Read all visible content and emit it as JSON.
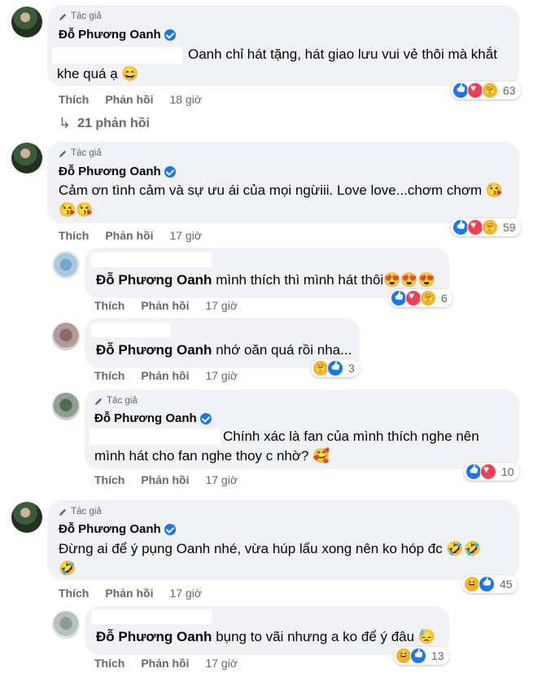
{
  "labels": {
    "author_tag": "Tác giả",
    "like": "Thích",
    "reply": "Phản hồi"
  },
  "comments": [
    {
      "author": "Đỗ Phương Oanh",
      "line1": "Oanh chỉ hát tặng, hát giao lưu vui vẻ thôi mà khắt",
      "line2": "khe quá ạ 😄",
      "time": "18 giờ",
      "reactions": [
        "like",
        "love",
        "care"
      ],
      "count": "63"
    },
    {
      "replies_label": "21 phản hồi"
    },
    {
      "author": "Đỗ Phương Oanh",
      "line1": "Cảm ơn tình cảm và sự ưu ái của mọi ngừiii. Love love...chơm chơm 😘",
      "line2": "😘😘",
      "time": "17 giờ",
      "reactions": [
        "like",
        "love",
        "care"
      ],
      "count": "59"
    },
    {
      "author": "Đỗ Phương Oanh",
      "text": "mình thích thì mình hát thôi😍😍😍",
      "time": "17 giờ",
      "reactions": [
        "like",
        "love",
        "care"
      ],
      "count": "6"
    },
    {
      "author": "Đỗ Phương Oanh",
      "text": "nhớ oăn quá rồi nha...",
      "time": "17 giờ",
      "reactions": [
        "care",
        "like"
      ],
      "count": "3"
    },
    {
      "author": "Đỗ Phương Oanh",
      "line1": "Chính xác là fan của mình thích nghe nên",
      "line2": "mình hát cho fan nghe thoy c nhờ? 🥰",
      "time": "17 giờ",
      "reactions": [
        "like",
        "love"
      ],
      "count": "10"
    },
    {
      "author": "Đỗ Phương Oanh",
      "line1": "Đừng ai để ý pụng Oanh nhé, vừa húp lẩu xong nên ko hóp đc 🤣🤣",
      "line2": "🤣",
      "time": "17 giờ",
      "reactions": [
        "haha",
        "like"
      ],
      "count": "45"
    },
    {
      "author": "Đỗ Phương Oanh",
      "text": "bụng to vãi nhưng a ko để ý đâu 😓",
      "time": "17 giờ",
      "reactions": [
        "haha",
        "like"
      ],
      "count": "13"
    }
  ]
}
